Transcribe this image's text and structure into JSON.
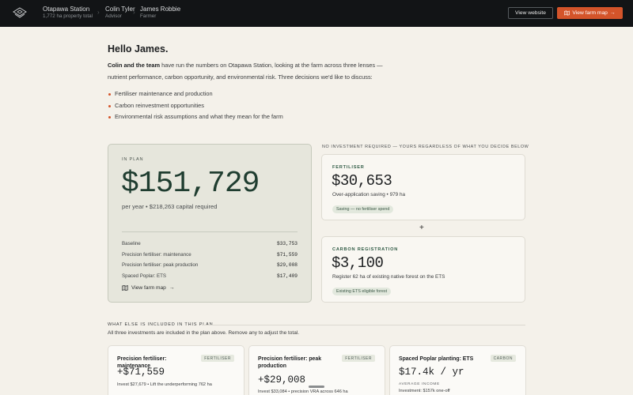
{
  "header": {
    "property_name": "Otapawa Station",
    "property_sub": "1,772 ha property total",
    "advisor_name": "Colin Tyler",
    "advisor_role": "Advisor",
    "farmer_name": "James Robbie",
    "farmer_role": "Farmer",
    "view_website_label": "View website",
    "view_farm_map_label": "View farm map",
    "accent_color": "#d4542a",
    "logo_icon": "layers-icon"
  },
  "intro": {
    "greeting": "Hello James.",
    "lead_bold": "Colin and the team",
    "lead_rest": " have run the numbers on Otapawa Station, looking at the farm across three lenses — nutrient performance, carbon opportunity, and environmental risk. Three decisions we'd like to discuss:",
    "bullets": [
      "Fertiliser maintenance and production",
      "Carbon reinvestment opportunities",
      "Environmental risk assumptions and what they mean for the farm"
    ]
  },
  "plan": {
    "eyebrow": "IN PLAN",
    "total": "$151,729",
    "subtitle": "per year • $218,263 capital required",
    "rows": [
      {
        "label": "Baseline",
        "value": "$33,753"
      },
      {
        "label": "Precision fertiliser: maintenance",
        "value": "$71,559"
      },
      {
        "label": "Precision fertiliser: peak production",
        "value": "$29,008"
      },
      {
        "label": "Spaced Poplar: ETS",
        "value": "$17,409"
      }
    ],
    "map_link_label": "View farm map"
  },
  "no_investment": {
    "heading": "NO INVESTMENT REQUIRED — YOURS REGARDLESS OF WHAT YOU DECIDE BELOW",
    "fertiliser": {
      "eyebrow": "FERTILISER",
      "value": "$30,653",
      "description": "Over-application saving • 979 ha",
      "pill": "Saving — no fertiliser spend"
    },
    "plus": "+",
    "carbon": {
      "eyebrow": "CARBON REGISTRATION",
      "value": "$3,100",
      "description": "Register 62 ha of existing native forest on the ETS",
      "pill": "Existing ETS eligible forest"
    }
  },
  "also_included": {
    "heading": "WHAT ELSE IS INCLUDED IN THIS PLAN",
    "subtitle": "All three investments are included in the plan above. Remove any to adjust the total.",
    "items": [
      {
        "name": "Precision fertiliser: maintenance",
        "tag": "FERTILISER",
        "amount": "+$71,559",
        "detail": "Invest $27,679 • Lift the underperforming 762 ha"
      },
      {
        "name": "Precision fertiliser: peak production",
        "tag": "FERTILISER",
        "amount": "+$29,008",
        "detail": "Invest $33,084 • precision VRA across 646 ha"
      },
      {
        "name": "Spaced Poplar planting: ETS",
        "tag": "CARBON",
        "amount": "$17.4k / yr",
        "avg_label": "AVERAGE INCOME",
        "detail": "Investment: $157k one-off"
      }
    ]
  }
}
